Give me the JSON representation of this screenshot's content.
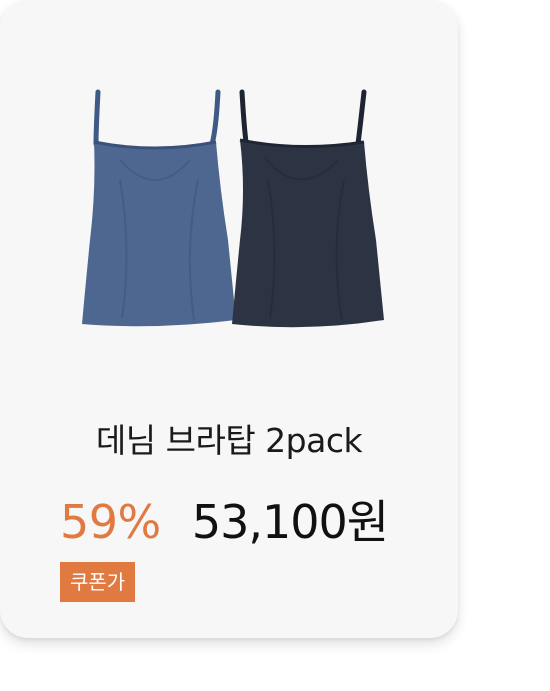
{
  "product": {
    "title": "데님 브라탑 2pack",
    "discount": "59%",
    "price": "53,100원",
    "coupon_label": "쿠폰가",
    "image_icon": "camisole-tops-pair-image"
  },
  "colors": {
    "card_bg": "#f7f7f7",
    "discount": "#e07a40",
    "badge_bg": "#e07a40",
    "top_blue": "#4e6790",
    "top_navy": "#2c3444"
  }
}
